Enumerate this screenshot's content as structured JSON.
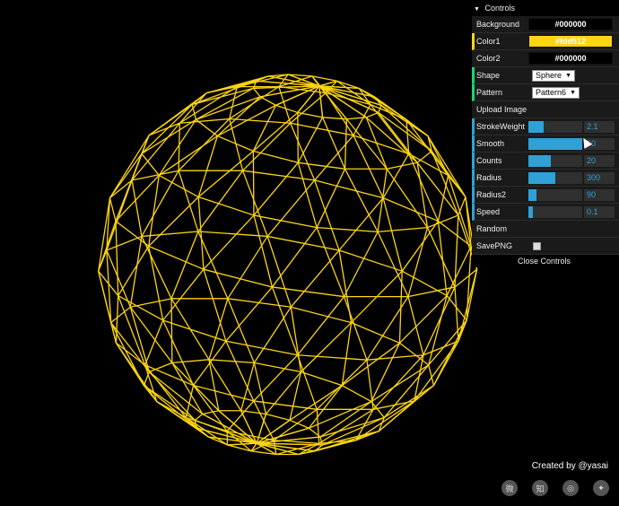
{
  "gui": {
    "title": "Controls",
    "background": {
      "label": "Background",
      "value": "#000000",
      "color": "#000000"
    },
    "color1": {
      "label": "Color1",
      "value": "#fdd512",
      "color": "#fdd512"
    },
    "color2": {
      "label": "Color2",
      "value": "#000000",
      "color": "#000000"
    },
    "shape": {
      "label": "Shape",
      "value": "Sphere"
    },
    "pattern": {
      "label": "Pattern",
      "value": "Pattern6"
    },
    "upload": {
      "label": "Upload Image"
    },
    "strokeWeight": {
      "label": "StrokeWeight",
      "value": "2.1",
      "fill": 0.29
    },
    "smooth": {
      "label": "Smooth",
      "value": "60",
      "fill": 1.0
    },
    "counts": {
      "label": "Counts",
      "value": "20",
      "fill": 0.42
    },
    "radius": {
      "label": "Radius",
      "value": "300",
      "fill": 0.5
    },
    "radius2": {
      "label": "Radius2",
      "value": "90",
      "fill": 0.15
    },
    "speed": {
      "label": "Speed",
      "value": "0.1",
      "fill": 0.08
    },
    "random": {
      "label": "Random"
    },
    "savepng": {
      "label": "SavePNG",
      "checked": false
    },
    "close": "Close Controls"
  },
  "credit": "Created by @yasai",
  "social": [
    {
      "icon": "weibo-icon",
      "glyph": "微"
    },
    {
      "icon": "zhihu-icon",
      "glyph": "知"
    },
    {
      "icon": "instagram-icon",
      "glyph": "◎"
    },
    {
      "icon": "twitter-icon",
      "glyph": "✦"
    }
  ],
  "colors": {
    "stroke": "#fdd512",
    "background": "#000000",
    "accent": "#2fa1d6"
  }
}
